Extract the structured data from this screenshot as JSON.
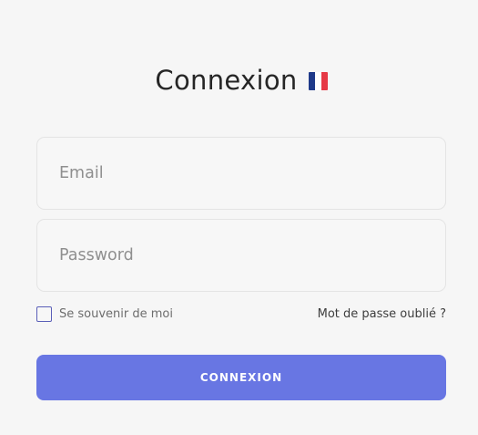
{
  "header": {
    "title": "Connexion",
    "flag_icon": "france-flag-icon",
    "flag_colors": [
      "#1f3a8a",
      "#ffffff",
      "#e63946"
    ]
  },
  "form": {
    "email_placeholder": "Email",
    "email_value": "",
    "password_placeholder": "Password",
    "password_value": "",
    "remember_label": "Se souvenir de moi",
    "remember_checked": false,
    "forgot_label": "Mot de passe oublié ?",
    "submit_label": "CONNEXION"
  },
  "colors": {
    "background": "#f6f6f6",
    "accent": "#6876e3",
    "checkbox_border": "#5a5fb8"
  }
}
